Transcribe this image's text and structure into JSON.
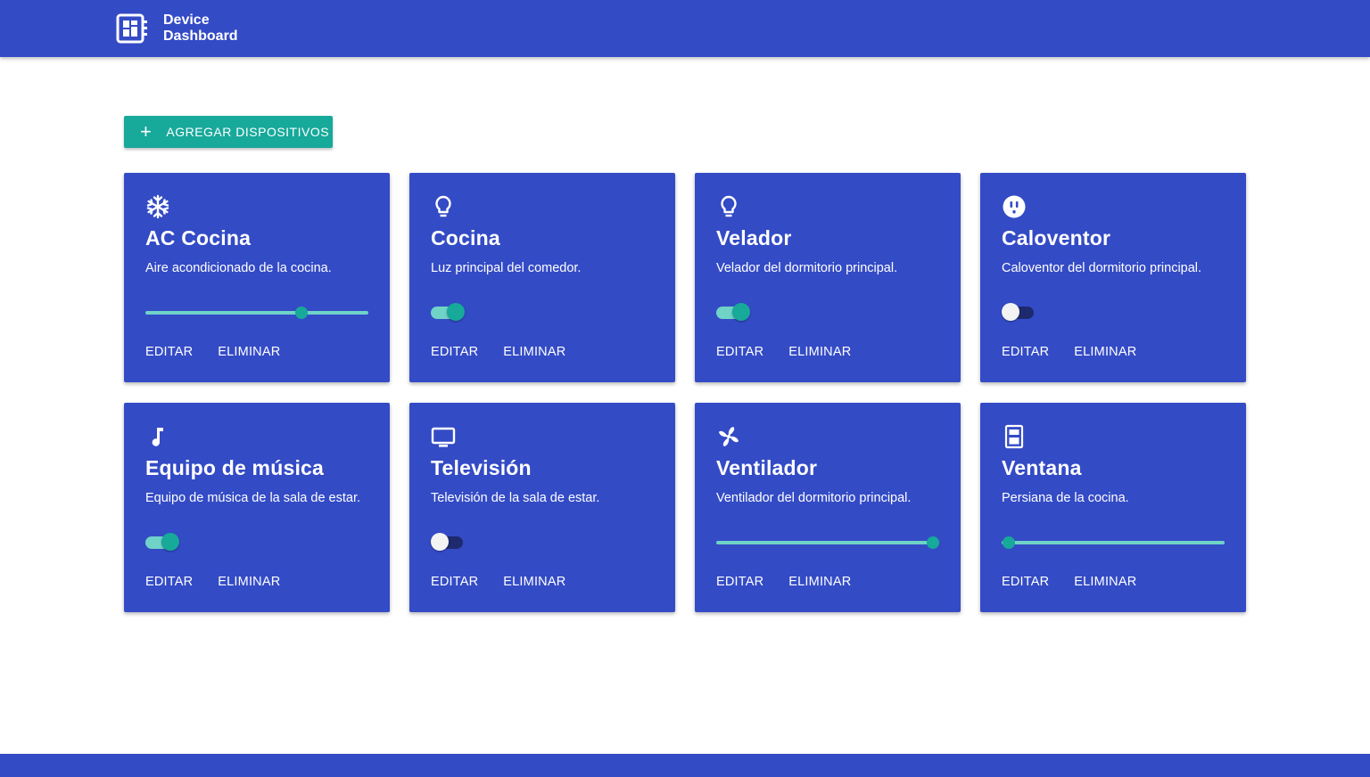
{
  "app": {
    "title_line1": "Device",
    "title_line2": "Dashboard",
    "icon": "dashboard-icon"
  },
  "toolbar": {
    "add_label": "AGREGAR DISPOSITIVOS",
    "add_icon": "plus-icon"
  },
  "colors": {
    "primary": "#344bc6",
    "accent": "#17a99a",
    "accent_light": "#6fd3c7",
    "switch_off_track": "#1d2a6e"
  },
  "devices": [
    {
      "name": "AC Cocina",
      "description": "Aire acondicionado de la cocina.",
      "icon": "snowflake-icon",
      "control": "slider",
      "level": 0.7,
      "edit_label": "EDITAR",
      "delete_label": "ELIMINAR"
    },
    {
      "name": "Cocina",
      "description": "Luz principal del comedor.",
      "icon": "lightbulb-icon",
      "control": "switch",
      "on": true,
      "edit_label": "EDITAR",
      "delete_label": "ELIMINAR"
    },
    {
      "name": "Velador",
      "description": "Velador del dormitorio principal.",
      "icon": "lightbulb-icon",
      "control": "switch",
      "on": true,
      "edit_label": "EDITAR",
      "delete_label": "ELIMINAR"
    },
    {
      "name": "Caloventor",
      "description": "Caloventor del dormitorio principal.",
      "icon": "power-outlet-icon",
      "control": "switch",
      "on": false,
      "edit_label": "EDITAR",
      "delete_label": "ELIMINAR"
    },
    {
      "name": "Equipo de música",
      "description": "Equipo de música de la sala de estar.",
      "icon": "music-note-icon",
      "control": "switch",
      "on": true,
      "edit_label": "EDITAR",
      "delete_label": "ELIMINAR"
    },
    {
      "name": "Televisión",
      "description": "Televisión de la sala de estar.",
      "icon": "tv-icon",
      "control": "switch",
      "on": false,
      "edit_label": "EDITAR",
      "delete_label": "ELIMINAR"
    },
    {
      "name": "Ventilador",
      "description": "Ventilador del dormitorio principal.",
      "icon": "fan-icon",
      "control": "slider",
      "level": 0.97,
      "edit_label": "EDITAR",
      "delete_label": "ELIMINAR"
    },
    {
      "name": "Ventana",
      "description": "Persiana de la cocina.",
      "icon": "window-blind-icon",
      "control": "slider",
      "level": 0.03,
      "edit_label": "EDITAR",
      "delete_label": "ELIMINAR"
    }
  ]
}
